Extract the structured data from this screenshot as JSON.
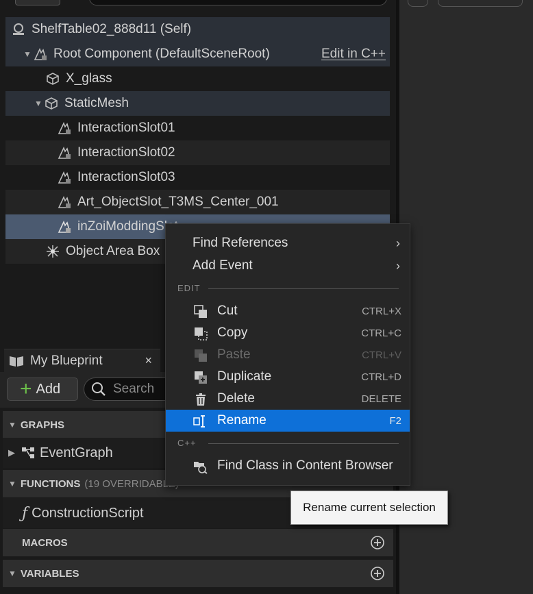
{
  "tree": {
    "items": [
      {
        "label": "ShelfTable02_888d11 (Self)"
      },
      {
        "label": "Root Component (DefaultSceneRoot)",
        "link": "Edit in C++"
      },
      {
        "label": "X_glass"
      },
      {
        "label": "StaticMesh"
      },
      {
        "label": "InteractionSlot01"
      },
      {
        "label": "InteractionSlot02"
      },
      {
        "label": "InteractionSlot03"
      },
      {
        "label": "Art_ObjectSlot_T3MS_Center_001"
      },
      {
        "label": "inZoiModdingSlot"
      },
      {
        "label": "Object Area Box"
      }
    ]
  },
  "blueprint": {
    "tab_label": "My Blueprint",
    "close_glyph": "×",
    "add_label": "Add",
    "search_placeholder": "Search",
    "sections": {
      "graphs": "GRAPHS",
      "functions": "FUNCTIONS",
      "functions_note": "(19 OVERRIDABLE)",
      "macros": "MACROS",
      "variables": "VARIABLES"
    },
    "event_graph": "EventGraph",
    "construction_script": "ConstructionScript"
  },
  "context_menu": {
    "find_references": "Find References",
    "add_event": "Add Event",
    "section_edit": "EDIT",
    "cut": {
      "label": "Cut",
      "shortcut": "CTRL+X"
    },
    "copy": {
      "label": "Copy",
      "shortcut": "CTRL+C"
    },
    "paste": {
      "label": "Paste",
      "shortcut": "CTRL+V"
    },
    "duplicate": {
      "label": "Duplicate",
      "shortcut": "CTRL+D"
    },
    "delete": {
      "label": "Delete",
      "shortcut": "DELETE"
    },
    "rename": {
      "label": "Rename",
      "shortcut": "F2"
    },
    "section_cpp": "C++",
    "find_class": "Find Class in Content Browser"
  },
  "tooltip": "Rename current selection",
  "colors": {
    "highlight": "#0e70d8",
    "selected_row": "#4b5a70",
    "add_plus": "#6cc04a"
  }
}
